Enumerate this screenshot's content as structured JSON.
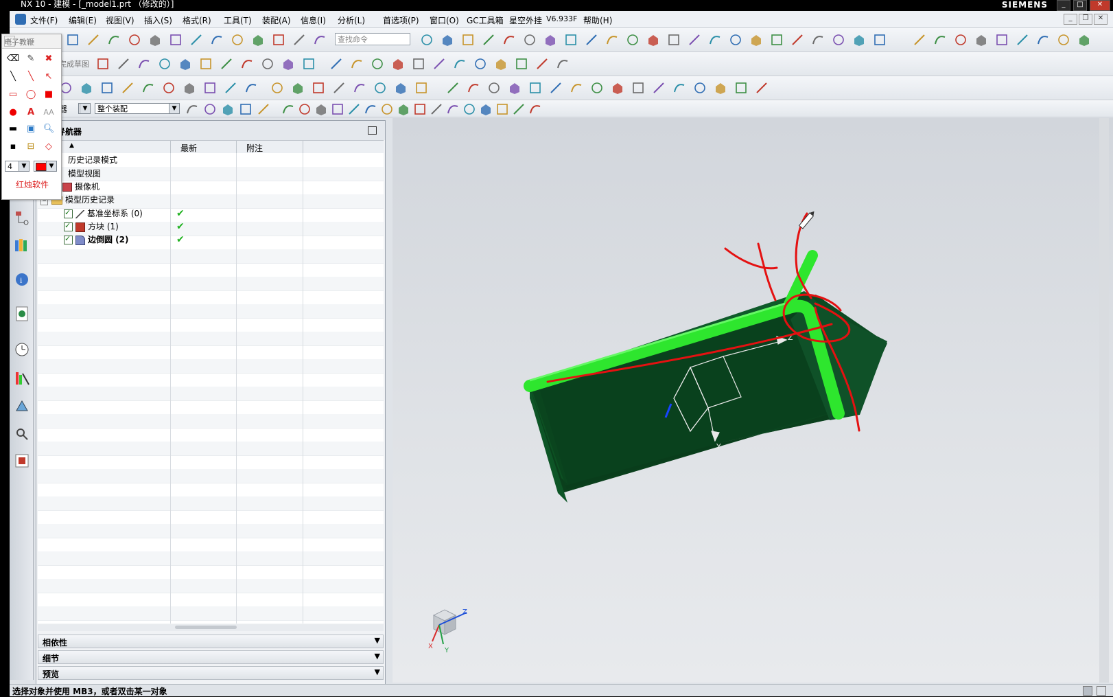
{
  "window": {
    "title": "NX 10 - 建模 - [_model1.prt （修改的）]",
    "brand": "SIEMENS"
  },
  "menu": [
    "文件(F)",
    "编辑(E)",
    "视图(V)",
    "插入(S)",
    "格式(R)",
    "工具(T)",
    "装配(A)",
    "信息(I)",
    "分析(L)",
    "首选项(P)",
    "窗口(O)",
    "GC工具箱",
    "星空外挂",
    "V6.933F",
    "帮助(H)"
  ],
  "toolbar": {
    "search_placeholder": "查找命令",
    "sketch_label": "完成草图",
    "filter_combo": "整个装配",
    "filter_label": "器"
  },
  "palette": {
    "title": "电子教鞭",
    "size_value": "4",
    "footer": "红烛软件",
    "pen_color": "#ff0000"
  },
  "navigator": {
    "title": "导航器",
    "columns": [
      "最新",
      "附注"
    ],
    "nodes": [
      {
        "label": "历史记录模式",
        "latest": ""
      },
      {
        "label": "模型视图",
        "latest": ""
      },
      {
        "label": "摄像机",
        "latest": ""
      },
      {
        "label": "模型历史记录",
        "latest": ""
      },
      {
        "label": "基准坐标系 (0)",
        "latest": "✔"
      },
      {
        "label": "方块 (1)",
        "latest": "✔"
      },
      {
        "label": "边倒圆 (2)",
        "latest": "✔"
      }
    ],
    "panels": [
      "相依性",
      "细节",
      "预览"
    ]
  },
  "viewport": {
    "axis_z": "Z",
    "axis_y": "Y",
    "axis_x": "X",
    "triad_z": "Z",
    "triad_y": "Y",
    "triad_x": "X"
  },
  "status": {
    "message": "选择对象并使用 MB3，或者双击某一对象"
  }
}
